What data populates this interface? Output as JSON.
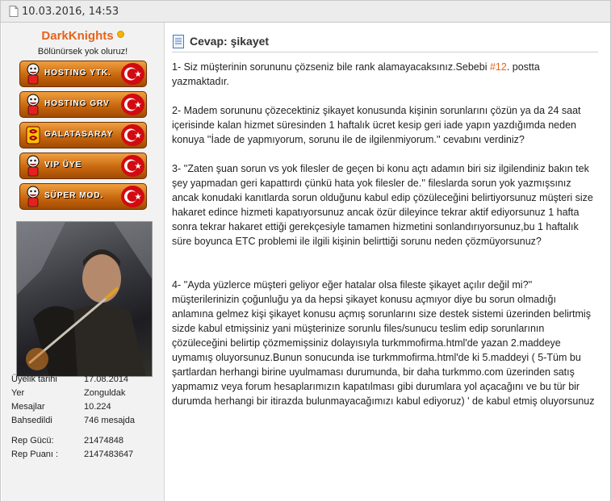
{
  "post": {
    "date": "10.03.2016, 14:53"
  },
  "user": {
    "username": "DarkKnights",
    "title": "Bölünürsek yok oluruz!",
    "ranks": [
      {
        "label": "HOSTING YTK."
      },
      {
        "label": "HOSTING GRV"
      },
      {
        "label": "GALATASARAY"
      },
      {
        "label": "VIP ÜYE"
      },
      {
        "label": "SÜPER MOD."
      }
    ],
    "stats": [
      {
        "label": "Üyelik tarihi",
        "value": "17.08.2014"
      },
      {
        "label": "Yer",
        "value": "Zonguldak"
      },
      {
        "label": "Mesajlar",
        "value": "10.224"
      },
      {
        "label": "Bahsedildi",
        "value": "746 mesajda"
      }
    ],
    "rep": [
      {
        "label": "Rep Gücü:",
        "value": "21474848"
      },
      {
        "label": "Rep Puanı :",
        "value": "2147483647"
      }
    ]
  },
  "content": {
    "title": "Cevap: şikayet",
    "p1_before": "1- Siz müşterinin sorununu çözseniz bile rank alamayacaksınız.Sebebi ",
    "p1_link": "#12",
    "p1_after": ". postta yazmaktadır.",
    "p2": "2- Madem sorununu çözecektiniz şikayet konusunda kişinin sorunlarını çözün ya da 24 saat içerisinde kalan hizmet süresinden 1 haftalık ücret kesip geri iade yapın yazdığımda neden konuya ''İade de yapmıyorum, sorunu ile de ilgilenmiyorum.'' cevabını verdiniz?",
    "p3": "3- ''Zaten şuan sorun vs yok filesler de geçen bi konu açtı adamın biri siz ilgilendiniz bakın tek şey yapmadan geri kapattırdı çünkü hata yok filesler de.'' fileslarda sorun yok yazmışsınız ancak konudaki kanıtlarda sorun olduğunu kabul edip çözüleceğini belirtiyorsunuz müşteri size hakaret edince hizmeti kapatıyorsunuz ancak özür dileyince tekrar aktif ediyorsunuz 1 hafta sonra tekrar hakaret ettiği gerekçesiyle tamamen hizmetini sonlandırıyorsunuz,bu 1 haftalık süre boyunca ETC problemi ile ilgili kişinin belirttiği sorunu neden çözmüyorsunuz?",
    "p4": "4- ''Ayda yüzlerce müşteri geliyor eğer hatalar olsa fileste şikayet açılır değil mi?'' müşterilerinizin çoğunluğu ya da hepsi şikayet konusu açmıyor diye bu sorun olmadığı anlamına gelmez kişi şikayet konusu açmış sorunlarını size destek sistemi üzerinden belirtmiş sizde kabul etmişsiniz yani müşterinize sorunlu files/sunucu teslim edip sorunlarının çözüleceğini belirtip çözmemişsiniz dolayısıyla turkmmofirma.html'de yazan 2.maddeye uymamış oluyorsunuz.Bunun sonucunda ise turkmmofirma.html'de ki 5.maddeyi ( 5-Tüm bu şartlardan herhangi birine uyulmaması durumunda, bir daha turkmmo.com üzerinden satış yapmamız veya forum hesaplarımızın kapatılması gibi durumlara yol açacağını ve bu tür bir durumda herhangi bir itirazda bulunmayacağımızı kabul ediyoruz) ' de kabul etmiş oluyorsunuz"
  }
}
